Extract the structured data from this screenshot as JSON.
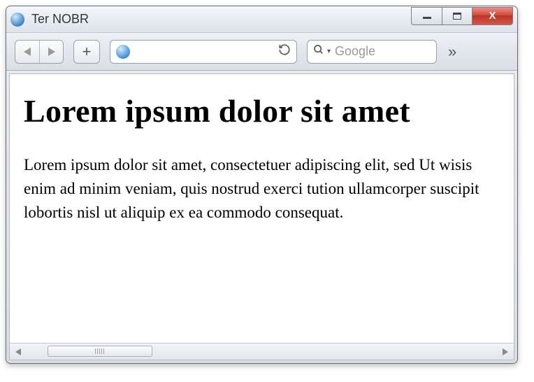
{
  "window": {
    "title": "Ter NOBR"
  },
  "toolbar": {
    "search_placeholder": "Google"
  },
  "page": {
    "heading": "Lorem ipsum dolor sit amet",
    "body": "Lorem ipsum dolor sit amet, consectetuer adipiscing elit, sed Ut wisis enim ad minim veniam, quis nostrud exerci tution ullamcorper suscipit lobortis nisl ut aliquip ex ea commodo consequat."
  }
}
